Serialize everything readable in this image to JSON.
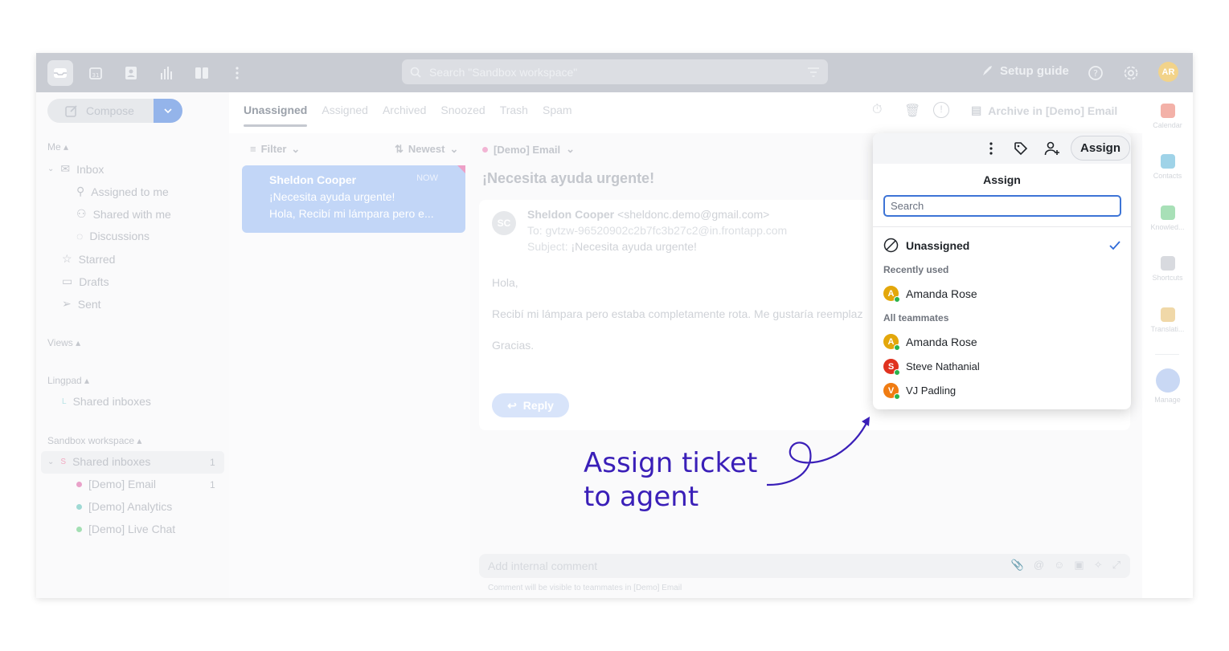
{
  "topbar": {
    "search_placeholder": "Search \"Sandbox workspace\"",
    "setup_guide": "Setup guide",
    "avatar_initials": "AR",
    "icons": [
      "inbox-icon",
      "calendar-icon",
      "contacts-icon",
      "analytics-icon",
      "split-view-icon",
      "more-icon"
    ]
  },
  "sidebar": {
    "compose_label": "Compose",
    "me_label": "Me",
    "inbox_label": "Inbox",
    "assigned_to_me": "Assigned to me",
    "shared_with_me": "Shared with me",
    "discussions": "Discussions",
    "starred": "Starred",
    "drafts": "Drafts",
    "sent": "Sent",
    "views_label": "Views",
    "lingpad_label": "Lingpad",
    "lingpad_shared_inboxes": "Shared inboxes",
    "lingpad_badge": "L",
    "sandbox_label": "Sandbox workspace",
    "sandbox_shared_inboxes": "Shared inboxes",
    "sandbox_badge": "S",
    "sandbox_count": "1",
    "inboxes": [
      {
        "label": "[Demo] Email",
        "count": "1",
        "color": "#e9a1c9"
      },
      {
        "label": "[Demo] Analytics",
        "count": "",
        "color": "#9fd9d4"
      },
      {
        "label": "[Demo] Live Chat",
        "count": "",
        "color": "#a3dfb3"
      }
    ]
  },
  "tabs": [
    "Unassigned",
    "Assigned",
    "Archived",
    "Snoozed",
    "Trash",
    "Spam"
  ],
  "toolbar": {
    "archive_label": "Archive in [Demo] Email"
  },
  "list": {
    "filter_label": "Filter",
    "sort_label": "Newest",
    "message": {
      "sender": "Sheldon Cooper",
      "time": "NOW",
      "subject": "¡Necesita ayuda urgente!",
      "preview": "Hola, Recibí mi lámpara pero e..."
    }
  },
  "email": {
    "inbox_label": "[Demo] Email",
    "title": "¡Necesita ayuda urgente!",
    "avatar_initials": "SC",
    "from_name": "Sheldon Cooper",
    "from_email": "<sheldonc.demo@gmail.com>",
    "to_line": "To: gvtzw-96520902c2b7fc3b27c2@in.frontapp.com",
    "subject_prefix": "Subject:",
    "subject": "¡Necesita ayuda urgente!",
    "greeting": "Hola,",
    "body": "Recibí mi lámpara pero estaba completamente rota. Me gustaría reemplaz",
    "signoff": "Gracias.",
    "reply_label": "Reply",
    "comment_placeholder": "Add internal comment",
    "comment_note": "Comment will be visible to teammates in [Demo] Email"
  },
  "rightrail": [
    {
      "label": "Calendar",
      "color": "#f3b1a8"
    },
    {
      "label": "Contacts",
      "color": "#9fd3e8"
    },
    {
      "label": "Knowled...",
      "color": "#a8e0b7"
    },
    {
      "label": "Shortcuts",
      "color": "#d8dadf"
    },
    {
      "label": "Translati...",
      "color": "#f0d8a8"
    },
    {
      "label": "Manage",
      "color": "#c9d8f4"
    }
  ],
  "assign_popup": {
    "button_label": "Assign",
    "title": "Assign",
    "search_placeholder": "Search",
    "unassigned": "Unassigned",
    "recently_used_label": "Recently used",
    "all_teammates_label": "All teammates",
    "recent": [
      {
        "name": "Amanda Rose",
        "initial": "A",
        "color": "#e3a70b"
      }
    ],
    "teammates": [
      {
        "name": "Amanda Rose",
        "initial": "A",
        "color": "#e3a70b"
      },
      {
        "name": "Steve Nathanial",
        "initial": "S",
        "color": "#e0321f"
      },
      {
        "name": "VJ Padling",
        "initial": "V",
        "color": "#f07c12"
      }
    ]
  },
  "annotation": {
    "line1": "Assign ticket",
    "line2": "to agent",
    "color": "#3a1fb8"
  }
}
